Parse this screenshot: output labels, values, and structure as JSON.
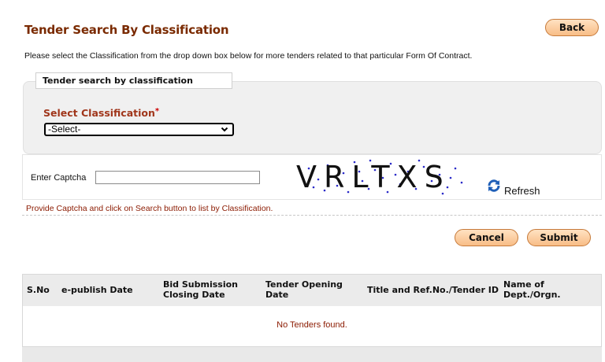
{
  "header": {
    "title": "Tender Search By Classification",
    "back_label": "Back"
  },
  "instruction": "Please select the Classification from the drop down box below for more tenders related to that particular Form Of Contract.",
  "classification_panel": {
    "legend": "Tender search by classification",
    "label": "Select Classification",
    "required_mark": "*",
    "selected_value": "-Select-"
  },
  "captcha": {
    "label": "Enter Captcha",
    "input_value": "",
    "image_text": "VRLTXS",
    "refresh_label": "Refresh",
    "hint": "Provide Captcha and click on Search button to list by Classification."
  },
  "actions": {
    "cancel_label": "Cancel",
    "submit_label": "Submit"
  },
  "table": {
    "columns": [
      "S.No",
      "e-publish Date",
      "Bid Submission Closing Date",
      "Tender Opening Date",
      "Title and Ref.No./Tender ID",
      "Name of Dept./Orgn."
    ],
    "empty_message": "No Tenders found."
  },
  "colors": {
    "title": "#7a2a00",
    "label": "#a0361b",
    "hint": "#8b1a00",
    "button_fill": "#f8bd86"
  }
}
